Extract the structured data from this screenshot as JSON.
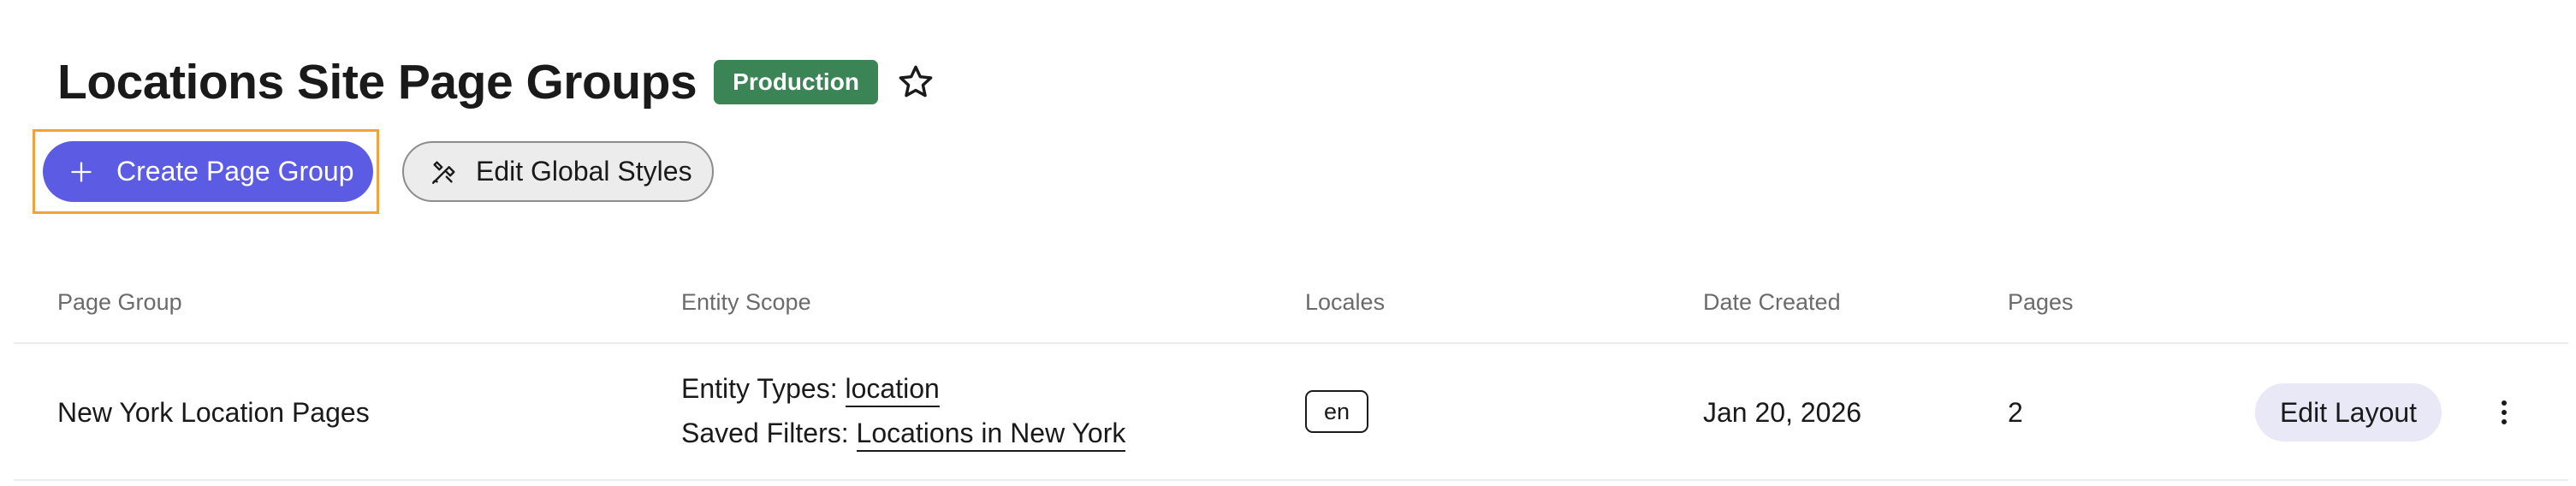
{
  "header": {
    "title": "Locations Site Page Groups",
    "environment_badge": "Production",
    "favorite_icon": "star-outline-icon"
  },
  "actions": {
    "create_label": "Create Page Group",
    "create_icon": "plus-icon",
    "edit_styles_label": "Edit Global Styles",
    "edit_styles_icon": "paint-brush-icon"
  },
  "table": {
    "columns": [
      "Page Group",
      "Entity Scope",
      "Locales",
      "Date Created",
      "Pages"
    ],
    "rows": [
      {
        "page_group": "New York Location Pages",
        "entity_types_label": "Entity Types:",
        "entity_types_value": "location",
        "saved_filters_label": "Saved Filters:",
        "saved_filters_value": "Locations in New York",
        "locale": "en",
        "date_created": "Jan 20, 2026",
        "pages": "2",
        "action_label": "Edit Layout",
        "menu_icon": "more-vertical-icon"
      }
    ]
  },
  "colors": {
    "primary": "#5b5be3",
    "badge_green": "#3b8455",
    "focus_ring": "#f5a13a"
  }
}
